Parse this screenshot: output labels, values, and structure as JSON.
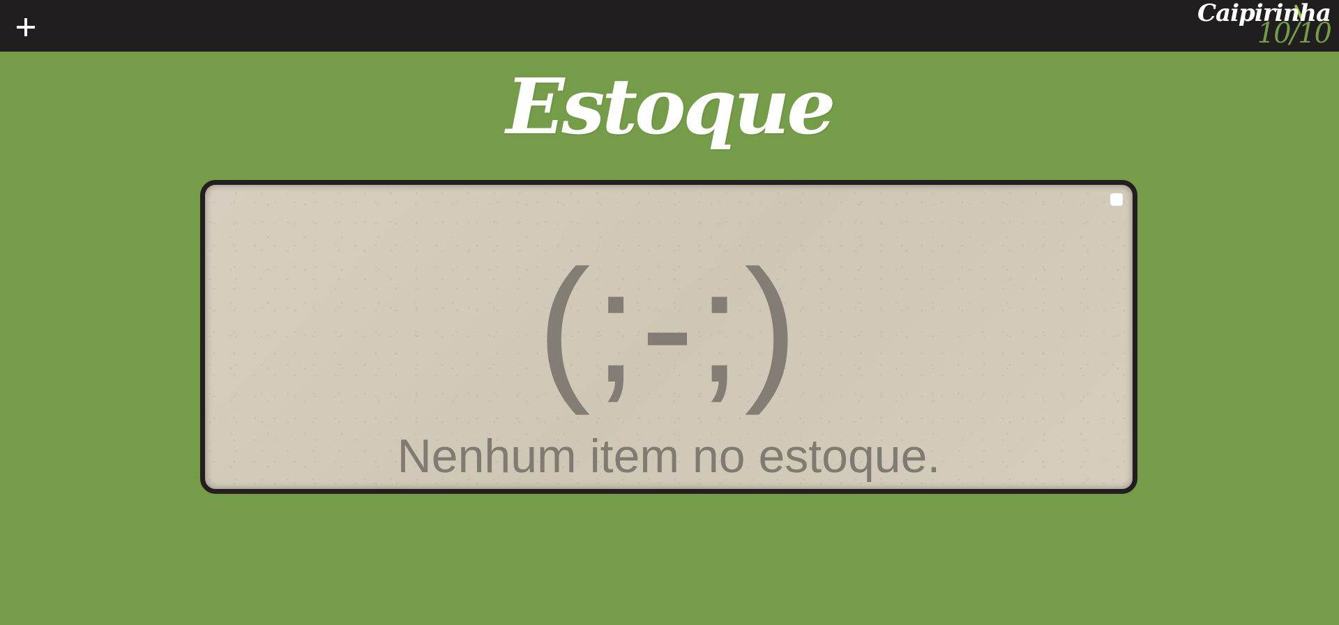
{
  "header": {
    "add_icon": "plus-icon",
    "logo": {
      "text": "Caipirinha",
      "score": "10/10"
    }
  },
  "page": {
    "title": "Estoque"
  },
  "stock": {
    "empty_face": "(;-;)",
    "empty_message": "Nenhum item no estoque.",
    "select_all_checked": false
  },
  "colors": {
    "background": "#759c49",
    "topbar": "#201e1f",
    "panel": "#d3cbbb",
    "panel_border": "#231f20",
    "empty_text": "#7f7a72"
  }
}
